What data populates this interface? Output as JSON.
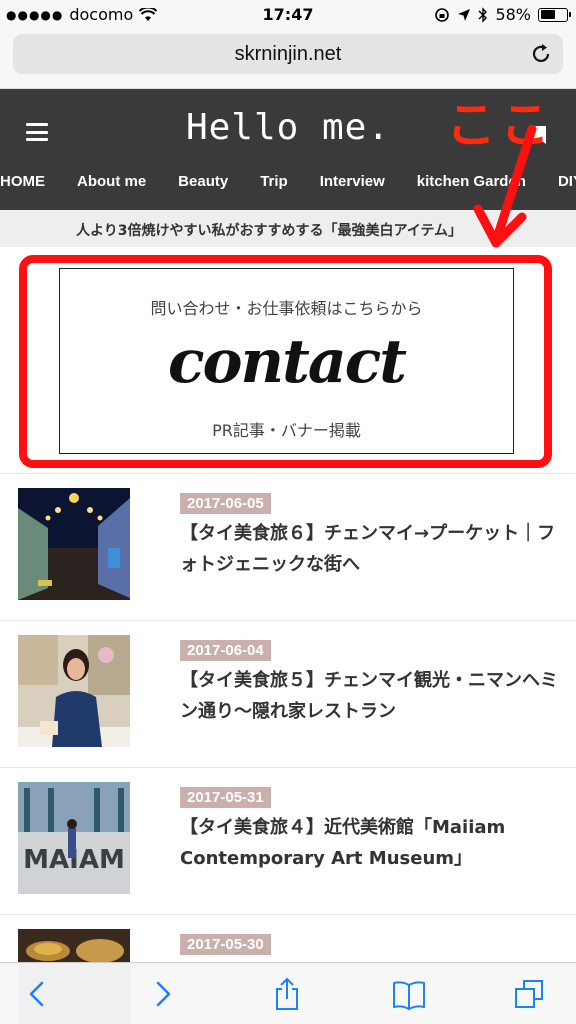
{
  "status_bar": {
    "carrier": "docomo",
    "time": "17:47",
    "battery": "58%",
    "battery_level": 0.58
  },
  "browser": {
    "url": "skrninjin.net"
  },
  "site": {
    "title": "Hello me.",
    "annotation": "ここ",
    "nav": [
      "HOME",
      "About me",
      "Beauty",
      "Trip",
      "Interview",
      "kitchen Garden",
      "DIY"
    ],
    "notice": "人より3倍焼けやすい私がおすすめする「最強美白アイテム」"
  },
  "contact_banner": {
    "top_text": "問い合わせ・お仕事依頼はこちらから",
    "script_text": "contact",
    "bottom_text": "PR記事・バナー掲載"
  },
  "posts": [
    {
      "date": "2017-06-05",
      "title": "【タイ美食旅６】チェンマイ→プーケット｜フォトジェニックな街へ"
    },
    {
      "date": "2017-06-04",
      "title": "【タイ美食旅５】チェンマイ観光・ニマンヘミン通り〜隠れ家レストラン"
    },
    {
      "date": "2017-05-31",
      "title": "【タイ美食旅４】近代美術館「Maiiam Contemporary Art Museum」"
    },
    {
      "date": "2017-05-30",
      "title": ""
    }
  ],
  "colors": {
    "header_bg": "#3a3a3a",
    "annotation_red": "#ff1010",
    "date_badge": "#c9b0ad",
    "ios_blue": "#1a82fb"
  }
}
